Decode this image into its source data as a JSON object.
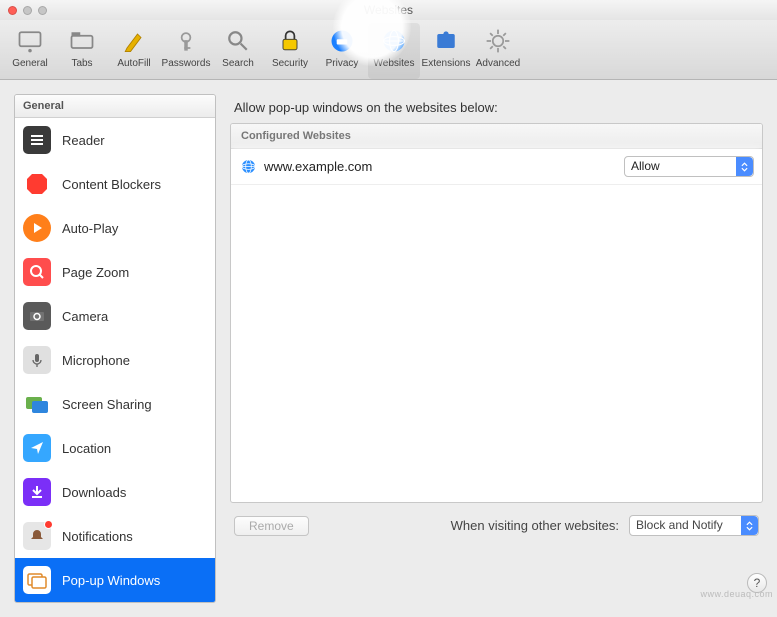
{
  "window": {
    "title": "Websites"
  },
  "toolbar": {
    "items": [
      {
        "label": "General",
        "name": "toolbar-general"
      },
      {
        "label": "Tabs",
        "name": "toolbar-tabs"
      },
      {
        "label": "AutoFill",
        "name": "toolbar-autofill"
      },
      {
        "label": "Passwords",
        "name": "toolbar-passwords"
      },
      {
        "label": "Search",
        "name": "toolbar-search"
      },
      {
        "label": "Security",
        "name": "toolbar-security"
      },
      {
        "label": "Privacy",
        "name": "toolbar-privacy"
      },
      {
        "label": "Websites",
        "name": "toolbar-websites"
      },
      {
        "label": "Extensions",
        "name": "toolbar-extensions"
      },
      {
        "label": "Advanced",
        "name": "toolbar-advanced"
      }
    ],
    "active": "Websites"
  },
  "sidebar": {
    "header": "General",
    "items": [
      {
        "label": "Reader",
        "name": "sidebar-reader"
      },
      {
        "label": "Content Blockers",
        "name": "sidebar-content-blockers"
      },
      {
        "label": "Auto-Play",
        "name": "sidebar-auto-play"
      },
      {
        "label": "Page Zoom",
        "name": "sidebar-page-zoom"
      },
      {
        "label": "Camera",
        "name": "sidebar-camera"
      },
      {
        "label": "Microphone",
        "name": "sidebar-microphone"
      },
      {
        "label": "Screen Sharing",
        "name": "sidebar-screen-sharing"
      },
      {
        "label": "Location",
        "name": "sidebar-location"
      },
      {
        "label": "Downloads",
        "name": "sidebar-downloads"
      },
      {
        "label": "Notifications",
        "name": "sidebar-notifications",
        "badge": true
      },
      {
        "label": "Pop-up Windows",
        "name": "sidebar-popup-windows",
        "selected": true
      }
    ]
  },
  "main": {
    "heading": "Allow pop-up windows on the websites below:",
    "list_header": "Configured Websites",
    "rows": [
      {
        "site": "www.example.com",
        "policy": "Allow"
      }
    ],
    "remove_label": "Remove",
    "other_label": "When visiting other websites:",
    "other_value": "Block and Notify"
  },
  "help": "?",
  "watermark": "www.deuaq.com"
}
